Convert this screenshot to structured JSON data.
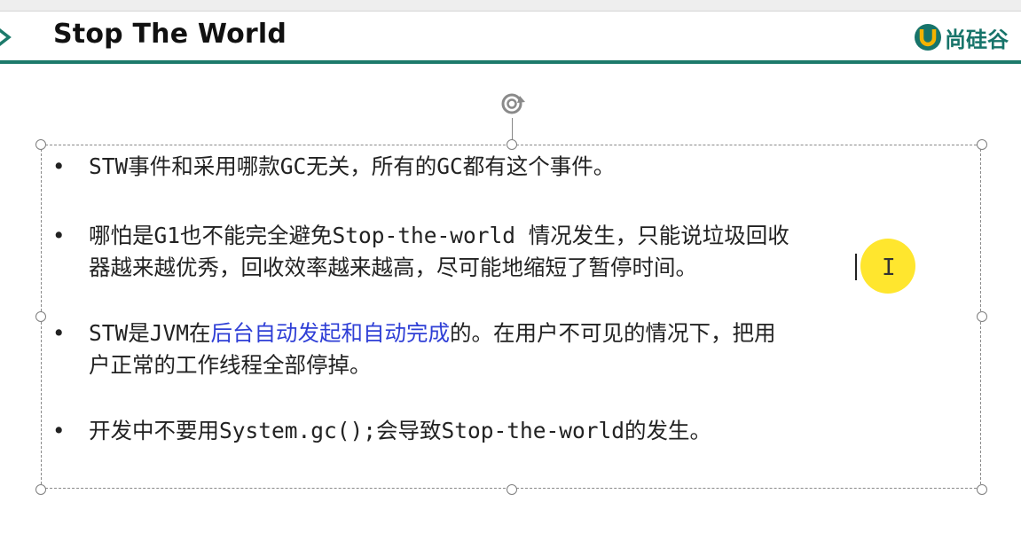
{
  "slide": {
    "title": "Stop The World",
    "logo_text": "尚硅谷"
  },
  "bullets": [
    {
      "symbol": "•",
      "lines": [
        {
          "segments": [
            {
              "text": "STW事件和采用哪款GC无关，所有的GC都有这个事件。",
              "highlight": false
            }
          ]
        }
      ]
    },
    {
      "symbol": "•",
      "lines": [
        {
          "segments": [
            {
              "text": "哪怕是G1也不能完全避免Stop-the-world 情况发生，只能说垃圾回收",
              "highlight": false
            }
          ]
        },
        {
          "segments": [
            {
              "text": "器越来越优秀，回收效率越来越高，尽可能地缩短了暂停时间。",
              "highlight": false
            }
          ]
        }
      ]
    },
    {
      "symbol": "•",
      "lines": [
        {
          "segments": [
            {
              "text": "STW是JVM在",
              "highlight": false
            },
            {
              "text": "后台自动发起和自动完成",
              "highlight": true
            },
            {
              "text": "的。在用户不可见的情况下，把用",
              "highlight": false
            }
          ]
        },
        {
          "segments": [
            {
              "text": "户正常的工作线程全部停掉。",
              "highlight": false
            }
          ]
        }
      ]
    },
    {
      "symbol": "•",
      "lines": [
        {
          "segments": [
            {
              "text": "开发中不要用System.gc();会导致Stop-the-world的发生。",
              "highlight": false
            }
          ]
        }
      ]
    }
  ],
  "cursor": {
    "ibeam_glyph": "I"
  },
  "colors": {
    "title_text": "#111111",
    "header_rule": "#1d7a6b",
    "logo": "#17746a",
    "body_text": "#222222",
    "highlight_text": "#2f3fd6",
    "pointer_halo": "#ffe000"
  },
  "icons": [
    "chevron-right-icon",
    "logo-u-icon",
    "rotate-icon",
    "ibeam-cursor-icon"
  ]
}
